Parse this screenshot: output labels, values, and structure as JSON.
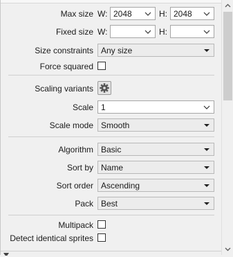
{
  "max_size": {
    "label": "Max size",
    "w_label": "W:",
    "w_value": "2048",
    "h_label": "H:",
    "h_value": "2048"
  },
  "fixed_size": {
    "label": "Fixed size",
    "w_label": "W:",
    "w_value": "",
    "h_label": "H:",
    "h_value": ""
  },
  "size_constraints": {
    "label": "Size constraints",
    "value": "Any size"
  },
  "force_squared": {
    "label": "Force squared",
    "checked": false
  },
  "scaling_variants": {
    "label": "Scaling variants",
    "icon": "gear-icon"
  },
  "scale": {
    "label": "Scale",
    "value": "1"
  },
  "scale_mode": {
    "label": "Scale mode",
    "value": "Smooth"
  },
  "algorithm": {
    "label": "Algorithm",
    "value": "Basic"
  },
  "sort_by": {
    "label": "Sort by",
    "value": "Name"
  },
  "sort_order": {
    "label": "Sort order",
    "value": "Ascending"
  },
  "pack": {
    "label": "Pack",
    "value": "Best"
  },
  "multipack": {
    "label": "Multipack",
    "checked": false
  },
  "detect_identical": {
    "label": "Detect identical sprites",
    "checked": false
  },
  "colors": {
    "field_border": "#a6a6a6",
    "readonly_bg": "#ececec",
    "separator": "#cfcfcf",
    "scroll_thumb": "#cdcdcd"
  }
}
